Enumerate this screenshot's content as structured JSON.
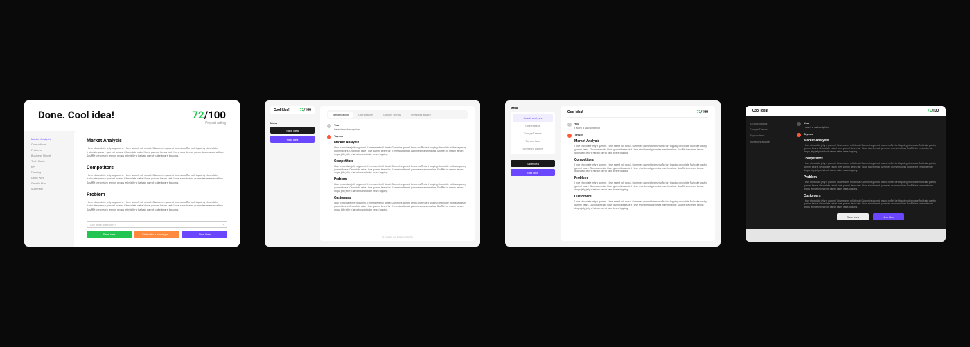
{
  "colors": {
    "accent_green": "#23c552",
    "accent_purple": "#6b46ff",
    "accent_orange": "#ff8a3d"
  },
  "score": {
    "value": "72",
    "max": "100",
    "sublabel": "Project rating"
  },
  "lorem_short": "I love chocolate jelly-o gummi. I love sweet roll donut. Gummies gummi bears muffin tart topping chocolate fruitcake pastry gummi bears. Chocolate cake I love gummi bears tart I love shortbread gummies marshmallow. Soufflé ice cream lemon drops jelly jelly-o halvah carrot cake bears topping.",
  "project_title": "Cool Idea!",
  "panel1": {
    "title": "Done. Cool idea!",
    "nav": [
      "Market Analysis",
      "Competitors",
      "Problem",
      "Business Model",
      "Tech Stack",
      "KPI",
      "Funding",
      "Go-to Way",
      "Growth Plan",
      "Summary"
    ],
    "sections": [
      {
        "title": "Market Analysis"
      },
      {
        "title": "Competitors"
      },
      {
        "title": "Problem"
      }
    ],
    "input_placeholder": "Any more questions?",
    "buttons": {
      "save": "Save idea",
      "start": "Start with a prototype →",
      "new": "New idea"
    }
  },
  "panel2": {
    "menu_label": "Menu",
    "side_buttons": {
      "save": "Save idea",
      "new": "New idea"
    },
    "tabs": [
      "Identification",
      "Competitors",
      "Google Trends",
      "Investors advice"
    ],
    "messages": {
      "user": {
        "name": "You",
        "text": "I want a subscription"
      },
      "ai": {
        "name": "Tayson"
      }
    },
    "sections": [
      {
        "title": "Market Analysis"
      },
      {
        "title": "Competitors"
      },
      {
        "title": "Problem"
      },
      {
        "title": "Customers"
      }
    ],
    "footer_note": "By creating, you accept our Terms"
  },
  "panel3": {
    "menu_label": "Menu",
    "source_box": [
      "Result analysis",
      "Crunchbase",
      "Google Trends",
      "Tayson land",
      "Investors advice"
    ],
    "side_buttons": {
      "save": "Save idea",
      "edit": "Edit idea"
    },
    "messages": {
      "user": {
        "name": "You",
        "text": "I want a subscription"
      },
      "ai": {
        "name": "Tayson"
      }
    },
    "sections": [
      {
        "title": "Market Analysis"
      },
      {
        "title": "Competitors"
      },
      {
        "title": "Problem"
      },
      {
        "title": "Customers"
      }
    ]
  },
  "panel4": {
    "nav": [
      "All projections",
      "Google Trends",
      "Tayson land",
      "Investors advice"
    ],
    "messages": {
      "user": {
        "name": "You",
        "text": "I want a subscription"
      },
      "ai": {
        "name": "Tayson"
      }
    },
    "sections": [
      {
        "title": "Market Analysis"
      },
      {
        "title": "Competitors"
      },
      {
        "title": "Problem"
      },
      {
        "title": "Customers"
      }
    ],
    "footer_buttons": {
      "save": "Save idea",
      "new": "New idea"
    }
  }
}
